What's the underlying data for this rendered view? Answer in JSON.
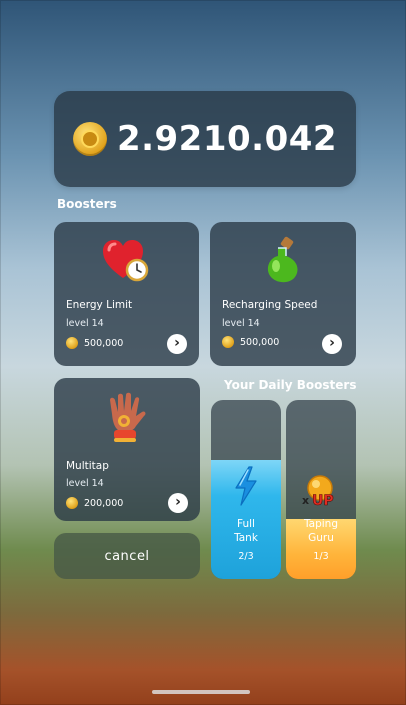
{
  "balance": {
    "value": "2.9210.042",
    "icon": "coin-icon"
  },
  "boosters": {
    "title": "Boosters",
    "items": [
      {
        "name": "Energy Limit",
        "level": "level 14",
        "price": "500,000",
        "icon": "heart-clock-icon"
      },
      {
        "name": "Recharging Speed",
        "level": "level 14",
        "price": "500,000",
        "icon": "potion-icon"
      },
      {
        "name": "Multitap",
        "level": "level 14",
        "price": "200,000",
        "icon": "glove-icon"
      }
    ]
  },
  "daily": {
    "title": "Your Daily Boosters",
    "items": [
      {
        "label_line1": "Full",
        "label_line2": "Tank",
        "count": "2/3",
        "fill": 0.6667,
        "color": "#2fb7ec",
        "icon": "lightning-icon"
      },
      {
        "label_line1": "Taping",
        "label_line2": "Guru",
        "count": "1/3",
        "fill": 0.3333,
        "color": "#ffb43a",
        "icon": "xup-icon"
      }
    ]
  },
  "cancel_label": "cancel",
  "colors": {
    "panel": "#28374480",
    "full_tank": "#2fb7ec",
    "taping_guru": "#ffb43a"
  }
}
